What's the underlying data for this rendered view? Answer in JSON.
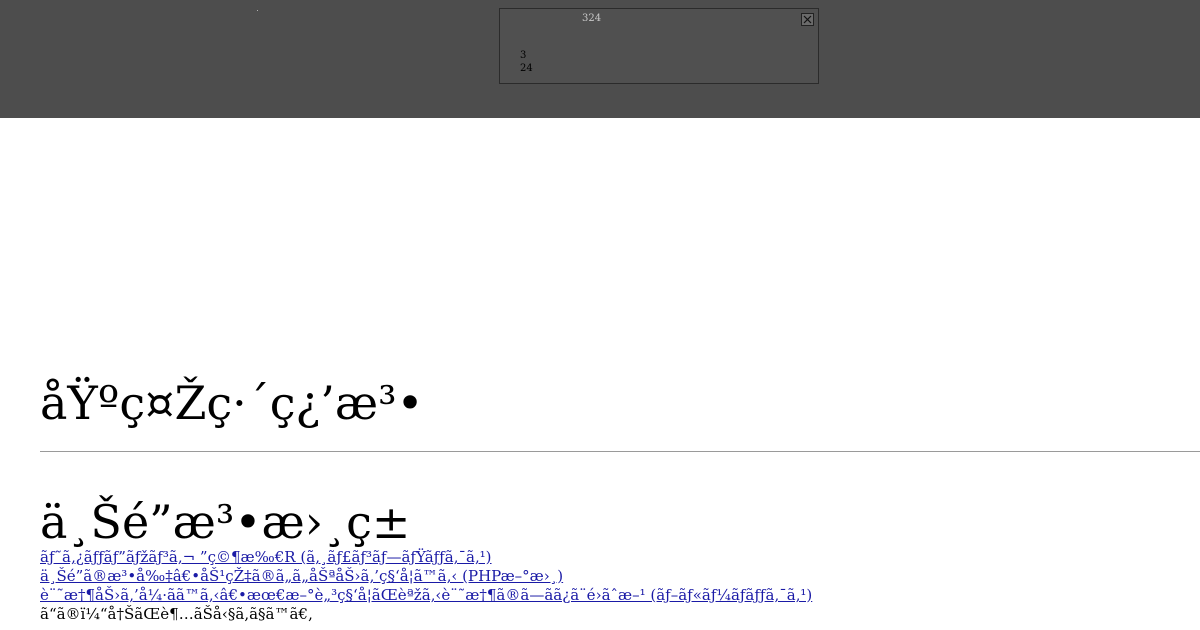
{
  "popup": {
    "title": "324",
    "line1": "3",
    "line2": "24"
  },
  "page": {
    "heading": "åŸºç¤Žç·´ç¿’æ³•",
    "subheading": "ä¸Šé”æ³•æ›¸ç±",
    "links": [
      "ãƒ˜ã‚¿ãƒƒãƒ”ãƒžãƒ³ã‚¬ ”ç©¶æ‰€R (ã‚¸ãƒ£ãƒ³ãƒ—ãƒŸãƒƒã‚¯ã‚¹)",
      "ä¸Šé”ã®æ³•å‰‡â€•åŠ¹çŽ‡ã®ã„ã„åŠªåŠ›ã‚’ç§‘å¦ã™ã‚‹ (PHPæ–°æ›¸)",
      "è¨˜æ†¶åŠ›ã‚’å¼·ãã™ã‚‹â€•æœ€æ–°è„³ç§‘å¦ãŒèªžã‚‹è¨˜æ†¶ã®ã—ãã¿ã¨é›ãˆæ–¹ (ãƒ–ãƒ«ãƒ¼ãƒãƒƒã‚¯ã‚¹)"
    ],
    "trailing_text": "ã“ã®ï¼“å†ŠãŒè¶…ãŠå‹§ã‚ã§ã™ã€‚"
  }
}
